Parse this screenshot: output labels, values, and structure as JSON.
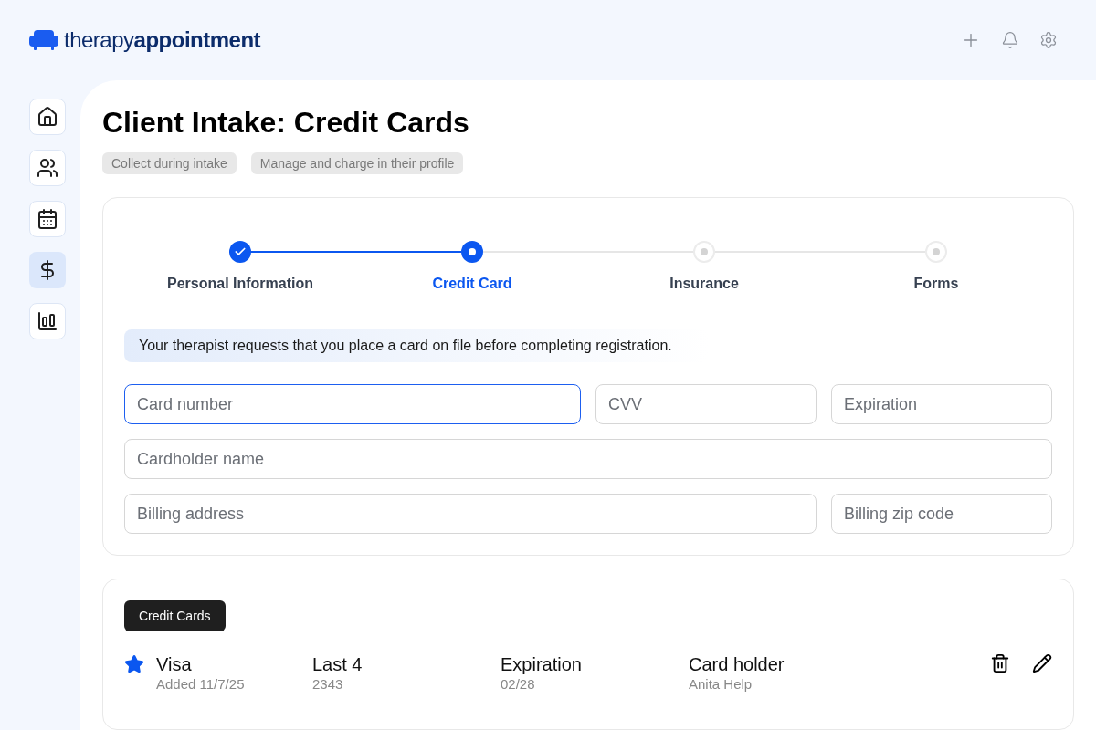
{
  "logo": {
    "text": "therapy**appointment**"
  },
  "nav": [
    {
      "selected": false
    },
    {
      "selected": false
    },
    {
      "selected": false
    },
    {
      "selected": true
    },
    {
      "selected": false
    }
  ],
  "page": {
    "title": "Client Intake: Credit Cards",
    "tags": [
      "Collect during intake",
      "Manage and charge in their profile"
    ]
  },
  "steps": [
    {
      "label": "Personal Information",
      "completed": true,
      "selected": false
    },
    {
      "label": "Credit Card",
      "completed": false,
      "selected": true
    },
    {
      "label": "Insurance",
      "completed": false,
      "selected": false
    },
    {
      "label": "Forms",
      "completed": false,
      "selected": false
    }
  ],
  "notice": "Your therapist requests that you place a card on file before completing registration.",
  "fields": [
    {
      "placeholder": "Card number",
      "focused": true
    },
    {
      "placeholder": "CVV",
      "focused": false
    },
    {
      "placeholder": "Expiration",
      "focused": false
    },
    {
      "placeholder": "Cardholder name",
      "focused": false
    },
    {
      "placeholder": "Billing address",
      "focused": false
    },
    {
      "placeholder": "Billing zip code",
      "focused": false
    }
  ],
  "cards_section": {
    "tab": "Credit Cards",
    "cards": [
      {
        "starred": true,
        "brand": "Visa",
        "added": "Added 11/7/25",
        "last4_label": "Last 4",
        "last4": "2343",
        "exp_label": "Expiration",
        "exp": "02/28",
        "holder_label": "Card holder",
        "holder": "Anita Help"
      }
    ]
  }
}
